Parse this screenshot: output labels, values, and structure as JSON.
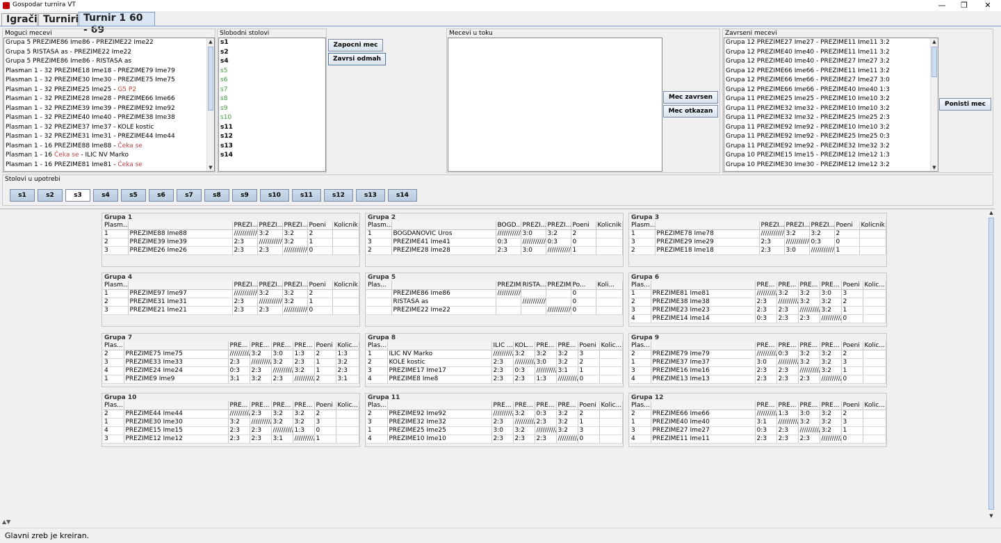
{
  "window": {
    "title": "Gospodar turnira VT",
    "minimize": "—",
    "restore": "❐",
    "close": "✕"
  },
  "tabs": [
    {
      "label": "Igrači"
    },
    {
      "label": "Turniri"
    },
    {
      "label": "Turnir 1 60 - 69",
      "active": true
    }
  ],
  "moguci": {
    "title": "Moguci mecevi",
    "items": [
      {
        "parts": [
          {
            "t": "Grupa 5 PREZIME86 Ime86 - PREZIME22 Ime22"
          }
        ]
      },
      {
        "parts": [
          {
            "t": "Grupa 5 RISTASA as - PREZIME22 Ime22"
          }
        ]
      },
      {
        "parts": [
          {
            "t": "Grupa 5 PREZIME86 Ime86 - RISTASA as"
          }
        ]
      },
      {
        "parts": [
          {
            "t": "Plasman 1 - 32 PREZIME18 Ime18 - PREZIME79 Ime79"
          }
        ]
      },
      {
        "parts": [
          {
            "t": "Plasman 1 - 32 PREZIME30 Ime30 - PREZIME75 Ime75"
          }
        ]
      },
      {
        "parts": [
          {
            "t": "Plasman 1 - 32 PREZIME25 Ime25 - "
          },
          {
            "t": "G5 P2",
            "c": "red"
          }
        ]
      },
      {
        "parts": [
          {
            "t": "Plasman 1 - 32 PREZIME28 Ime28 - PREZIME66 Ime66"
          }
        ]
      },
      {
        "parts": [
          {
            "t": "Plasman 1 - 32 PREZIME39 Ime39 - PREZIME92 Ime92"
          }
        ]
      },
      {
        "parts": [
          {
            "t": "Plasman 1 - 32 PREZIME40 Ime40 - PREZIME38 Ime38"
          }
        ]
      },
      {
        "parts": [
          {
            "t": "Plasman 1 - 32 PREZIME37 Ime37 - KOLE kostic"
          }
        ]
      },
      {
        "parts": [
          {
            "t": "Plasman 1 - 32 PREZIME31 Ime31 - PREZIME44 Ime44"
          }
        ]
      },
      {
        "parts": [
          {
            "t": "Plasman 1 - 16 PREZIME88 Ime88 - "
          },
          {
            "t": "Čeka se",
            "c": "red"
          }
        ]
      },
      {
        "parts": [
          {
            "t": "Plasman 1 - 16 "
          },
          {
            "t": "Čeka se",
            "c": "red"
          },
          {
            "t": " - ILIC NV Marko"
          }
        ]
      },
      {
        "parts": [
          {
            "t": "Plasman 1 - 16 PREZIME81 Ime81 - "
          },
          {
            "t": "Čeka se",
            "c": "red"
          }
        ]
      }
    ]
  },
  "slobodni": {
    "title": "Slobodni stolovi",
    "items": [
      {
        "label": "s1",
        "free": false
      },
      {
        "label": "s2",
        "free": false
      },
      {
        "label": "s4",
        "free": false
      },
      {
        "label": "s5",
        "free": true
      },
      {
        "label": "s6",
        "free": true
      },
      {
        "label": "s7",
        "free": true
      },
      {
        "label": "s8",
        "free": true
      },
      {
        "label": "s9",
        "free": true
      },
      {
        "label": "s10",
        "free": true
      },
      {
        "label": "s11",
        "free": false
      },
      {
        "label": "s12",
        "free": false
      },
      {
        "label": "s13",
        "free": false
      },
      {
        "label": "s14",
        "free": false
      }
    ]
  },
  "buttons": {
    "zapocni": "Zapocni mec",
    "zavrsi_odmah": "Zavrsi odmah",
    "mec_zavrsen": "Mec zavrsen",
    "mec_otkazan": "Mec otkazan",
    "ponisti": "Ponisti mec"
  },
  "u_toku": {
    "title": "Mecevi u toku",
    "items": []
  },
  "zavrseni": {
    "title": "Zavrseni mecevi",
    "items": [
      "Grupa 12 PREZIME27 Ime27 - PREZIME11 Ime11 3:2",
      "Grupa 12 PREZIME40 Ime40 - PREZIME11 Ime11 3:2",
      "Grupa 12 PREZIME40 Ime40 - PREZIME27 Ime27 3:2",
      "Grupa 12 PREZIME66 Ime66 - PREZIME11 Ime11 3:2",
      "Grupa 12 PREZIME66 Ime66 - PREZIME27 Ime27 3:0",
      "Grupa 12 PREZIME66 Ime66 - PREZIME40 Ime40 1:3",
      "Grupa 11 PREZIME25 Ime25 - PREZIME10 Ime10 3:2",
      "Grupa 11 PREZIME32 Ime32 - PREZIME10 Ime10 3:2",
      "Grupa 11 PREZIME32 Ime32 - PREZIME25 Ime25 2:3",
      "Grupa 11 PREZIME92 Ime92 - PREZIME10 Ime10 3:2",
      "Grupa 11 PREZIME92 Ime92 - PREZIME25 Ime25 0:3",
      "Grupa 11 PREZIME92 Ime92 - PREZIME32 Ime32 3:2",
      "Grupa 10 PREZIME15 Ime15 - PREZIME12 Ime12 1:3",
      "Grupa 10 PREZIME30 Ime30 - PREZIME12 Ime12 3:2"
    ]
  },
  "stolovi_upotrebi": {
    "title": "Stolovi u upotrebi",
    "tables": [
      "s1",
      "s2",
      "s3",
      "s4",
      "s5",
      "s6",
      "s7",
      "s8",
      "s9",
      "s10",
      "s11",
      "s12",
      "s13",
      "s14"
    ],
    "selected": "s3"
  },
  "groups": [
    {
      "title": "Grupa 1",
      "headers": [
        "Plasm...",
        "",
        "PREZI...",
        "PREZI...",
        "PREZI...",
        "Poeni",
        "Kolicnik"
      ],
      "rows": [
        [
          "1",
          "PREZIME88 Ime88",
          "////////////",
          "3:2",
          "3:2",
          "2",
          ""
        ],
        [
          "2",
          "PREZIME39 Ime39",
          "2:3",
          "////////////",
          "3:2",
          "1",
          ""
        ],
        [
          "3",
          "PREZIME26 Ime26",
          "2:3",
          "2:3",
          "////////////",
          "0",
          ""
        ]
      ]
    },
    {
      "title": "Grupa 2",
      "headers": [
        "Plasm...",
        "",
        "BOGD...",
        "PREZI...",
        "PREZI...",
        "Poeni",
        "Kolicnik"
      ],
      "rows": [
        [
          "1",
          "BOGDANOVIC Uros",
          "////////////",
          "3:0",
          "3:2",
          "2",
          ""
        ],
        [
          "3",
          "PREZIME41 Ime41",
          "0:3",
          "////////////",
          "0:3",
          "0",
          ""
        ],
        [
          "2",
          "PREZIME28 Ime28",
          "2:3",
          "3:0",
          "////////////",
          "1",
          ""
        ]
      ]
    },
    {
      "title": "Grupa 3",
      "headers": [
        "Plasm...",
        "",
        "PREZI...",
        "PREZI...",
        "PREZI...",
        "Poeni",
        "Kolicnik"
      ],
      "rows": [
        [
          "1",
          "PREZIME78 Ime78",
          "////////////",
          "3:2",
          "3:2",
          "2",
          ""
        ],
        [
          "3",
          "PREZIME29 Ime29",
          "2:3",
          "////////////",
          "0:3",
          "0",
          ""
        ],
        [
          "2",
          "PREZIME18 Ime18",
          "2:3",
          "3:0",
          "////////////",
          "1",
          ""
        ]
      ]
    },
    {
      "title": "Grupa 4",
      "headers": [
        "Plasm...",
        "",
        "PREZI...",
        "PREZI...",
        "PREZI...",
        "Poeni",
        "Kolicnik"
      ],
      "rows": [
        [
          "1",
          "PREZIME97 Ime97",
          "////////////",
          "3:2",
          "3:2",
          "2",
          ""
        ],
        [
          "2",
          "PREZIME31 Ime31",
          "2:3",
          "////////////",
          "3:2",
          "1",
          ""
        ],
        [
          "3",
          "PREZIME21 Ime21",
          "2:3",
          "2:3",
          "////////////",
          "0",
          ""
        ]
      ]
    },
    {
      "title": "Grupa 5",
      "headers": [
        "Plas...",
        "",
        "PREZIME8...",
        "RISTA...",
        "PREZIME2...",
        "Po...",
        "Koli..."
      ],
      "rows": [
        [
          "",
          "PREZIME86 Ime86",
          "////////////",
          "",
          "",
          "0",
          ""
        ],
        [
          "",
          "RISTASA as",
          "",
          "////////////",
          "",
          "0",
          ""
        ],
        [
          "",
          "PREZIME22 Ime22",
          "",
          "",
          "////////////",
          "0",
          ""
        ]
      ]
    },
    {
      "title": "Grupa 6",
      "headers": [
        "Plas...",
        "",
        "PRE...",
        "PRE...",
        "PRE...",
        "PRE...",
        "Poeni",
        "Kolic..."
      ],
      "rows": [
        [
          "1",
          "PREZIME81 Ime81",
          "////////////",
          "3:2",
          "3:2",
          "3:0",
          "3",
          ""
        ],
        [
          "2",
          "PREZIME38 Ime38",
          "2:3",
          "////////////",
          "3:2",
          "3:2",
          "2",
          ""
        ],
        [
          "3",
          "PREZIME23 Ime23",
          "2:3",
          "2:3",
          "////////////",
          "3:2",
          "1",
          ""
        ],
        [
          "4",
          "PREZIME14 Ime14",
          "0:3",
          "2:3",
          "2:3",
          "////////////",
          "0",
          ""
        ]
      ]
    },
    {
      "title": "Grupa 7",
      "headers": [
        "Plas...",
        "",
        "PRE...",
        "PRE...",
        "PRE...",
        "PRE...",
        "Poeni",
        "Kolic..."
      ],
      "rows": [
        [
          "2",
          "PREZIME75 Ime75",
          "////////////",
          "3:2",
          "3:0",
          "1:3",
          "2",
          "1:3"
        ],
        [
          "3",
          "PREZIME33 Ime33",
          "2:3",
          "////////////",
          "3:2",
          "2:3",
          "1",
          "3:2"
        ],
        [
          "4",
          "PREZIME24 Ime24",
          "0:3",
          "2:3",
          "////////////",
          "3:2",
          "1",
          "2:3"
        ],
        [
          "1",
          "PREZIME9 Ime9",
          "3:1",
          "3:2",
          "2:3",
          "////////////",
          "2",
          "3:1"
        ]
      ]
    },
    {
      "title": "Grupa 8",
      "headers": [
        "Plas...",
        "",
        "ILIC ...",
        "KOL...",
        "PRE...",
        "PRE...",
        "Poeni",
        "Kolic..."
      ],
      "rows": [
        [
          "1",
          "ILIC NV Marko",
          "////////////",
          "3:2",
          "3:2",
          "3:2",
          "3",
          ""
        ],
        [
          "2",
          "KOLE kostic",
          "2:3",
          "////////////",
          "3:0",
          "3:2",
          "2",
          ""
        ],
        [
          "3",
          "PREZIME17 Ime17",
          "2:3",
          "0:3",
          "////////////",
          "3:1",
          "1",
          ""
        ],
        [
          "4",
          "PREZIME8 Ime8",
          "2:3",
          "2:3",
          "1:3",
          "////////////",
          "0",
          ""
        ]
      ]
    },
    {
      "title": "Grupa 9",
      "headers": [
        "Plas...",
        "",
        "PRE...",
        "PRE...",
        "PRE...",
        "PRE...",
        "Poeni",
        "Kolic..."
      ],
      "rows": [
        [
          "2",
          "PREZIME79 Ime79",
          "////////////",
          "0:3",
          "3:2",
          "3:2",
          "2",
          ""
        ],
        [
          "1",
          "PREZIME37 Ime37",
          "3:0",
          "////////////",
          "3:2",
          "3:2",
          "3",
          ""
        ],
        [
          "3",
          "PREZIME16 Ime16",
          "2:3",
          "2:3",
          "////////////",
          "3:2",
          "1",
          ""
        ],
        [
          "4",
          "PREZIME13 Ime13",
          "2:3",
          "2:3",
          "2:3",
          "////////////",
          "0",
          ""
        ]
      ]
    },
    {
      "title": "Grupa 10",
      "headers": [
        "Plas...",
        "",
        "PRE...",
        "PRE...",
        "PRE...",
        "PRE...",
        "Poeni",
        "Kolic..."
      ],
      "rows": [
        [
          "2",
          "PREZIME44 Ime44",
          "////////////",
          "2:3",
          "3:2",
          "3:2",
          "2",
          ""
        ],
        [
          "1",
          "PREZIME30 Ime30",
          "3:2",
          "////////////",
          "3:2",
          "3:2",
          "3",
          ""
        ],
        [
          "4",
          "PREZIME15 Ime15",
          "2:3",
          "2:3",
          "////////////",
          "1:3",
          "0",
          ""
        ],
        [
          "3",
          "PREZIME12 Ime12",
          "2:3",
          "2:3",
          "3:1",
          "////////////",
          "1",
          ""
        ]
      ]
    },
    {
      "title": "Grupa 11",
      "headers": [
        "Plas...",
        "",
        "PRE...",
        "PRE...",
        "PRE...",
        "PRE...",
        "Poeni",
        "Kolic..."
      ],
      "rows": [
        [
          "2",
          "PREZIME92 Ime92",
          "////////////",
          "3:2",
          "0:3",
          "3:2",
          "2",
          ""
        ],
        [
          "3",
          "PREZIME32 Ime32",
          "2:3",
          "////////////",
          "2:3",
          "3:2",
          "1",
          ""
        ],
        [
          "1",
          "PREZIME25 Ime25",
          "3:0",
          "3:2",
          "////////////",
          "3:2",
          "3",
          ""
        ],
        [
          "4",
          "PREZIME10 Ime10",
          "2:3",
          "2:3",
          "2:3",
          "////////////",
          "0",
          ""
        ]
      ]
    },
    {
      "title": "Grupa 12",
      "headers": [
        "Plas...",
        "",
        "PRE...",
        "PRE...",
        "PRE...",
        "PRE...",
        "Poeni",
        "Kolic..."
      ],
      "rows": [
        [
          "2",
          "PREZIME66 Ime66",
          "////////////",
          "1:3",
          "3:0",
          "3:2",
          "2",
          ""
        ],
        [
          "1",
          "PREZIME40 Ime40",
          "3:1",
          "////////////",
          "3:2",
          "3:2",
          "3",
          ""
        ],
        [
          "3",
          "PREZIME27 Ime27",
          "0:3",
          "2:3",
          "////////////",
          "3:2",
          "1",
          ""
        ],
        [
          "4",
          "PREZIME11 Ime11",
          "2:3",
          "2:3",
          "2:3",
          "////////////",
          "0",
          ""
        ]
      ]
    }
  ],
  "status": "Glavni zreb je kreiran."
}
